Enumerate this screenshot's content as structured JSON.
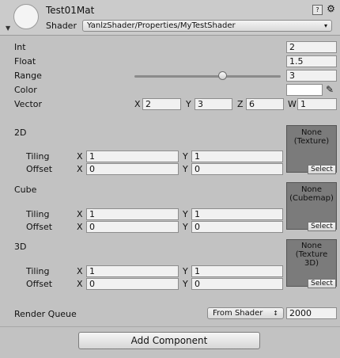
{
  "header": {
    "material_name": "Test01Mat",
    "shader_label": "Shader",
    "shader_value": "YanlzShader/Properties/MyTestShader",
    "fold_arrow": "▼",
    "dropdown_arrow": "▾",
    "icons": [
      "book-help-icon",
      "gear-icon"
    ],
    "help_glyph": "?",
    "gear_glyph": "⚙"
  },
  "properties": {
    "int": {
      "label": "Int",
      "value": "2"
    },
    "float": {
      "label": "Float",
      "value": "1.5"
    },
    "range": {
      "label": "Range",
      "value": "3",
      "fraction": 0.6
    },
    "color": {
      "label": "Color",
      "value": "#ffffff",
      "eyedropper": "✎"
    },
    "vector": {
      "label": "Vector",
      "x_label": "X",
      "x": "2",
      "y_label": "Y",
      "y": "3",
      "z_label": "Z",
      "z": "6",
      "w_label": "W",
      "w": "1"
    }
  },
  "textures": [
    {
      "label": "2D",
      "tiling_label": "Tiling",
      "offset_label": "Offset",
      "tiling_x": "1",
      "tiling_y": "1",
      "offset_x": "0",
      "offset_y": "0",
      "slot_line1": "None",
      "slot_line2": "(Texture)",
      "slot_line3": "",
      "select_label": "Select",
      "x_label": "X",
      "y_label": "Y"
    },
    {
      "label": "Cube",
      "tiling_label": "Tiling",
      "offset_label": "Offset",
      "tiling_x": "1",
      "tiling_y": "1",
      "offset_x": "0",
      "offset_y": "0",
      "slot_line1": "None",
      "slot_line2": "(Cubemap)",
      "slot_line3": "",
      "select_label": "Select",
      "x_label": "X",
      "y_label": "Y"
    },
    {
      "label": "3D",
      "tiling_label": "Tiling",
      "offset_label": "Offset",
      "tiling_x": "1",
      "tiling_y": "1",
      "offset_x": "0",
      "offset_y": "0",
      "slot_line1": "None",
      "slot_line2": "(Texture",
      "slot_line3": "3D)",
      "select_label": "Select",
      "x_label": "X",
      "y_label": "Y"
    }
  ],
  "render_queue": {
    "label": "Render Queue",
    "mode": "From Shader",
    "value": "2000",
    "arrow": "↕"
  },
  "footer": {
    "add_component_label": "Add Component"
  }
}
